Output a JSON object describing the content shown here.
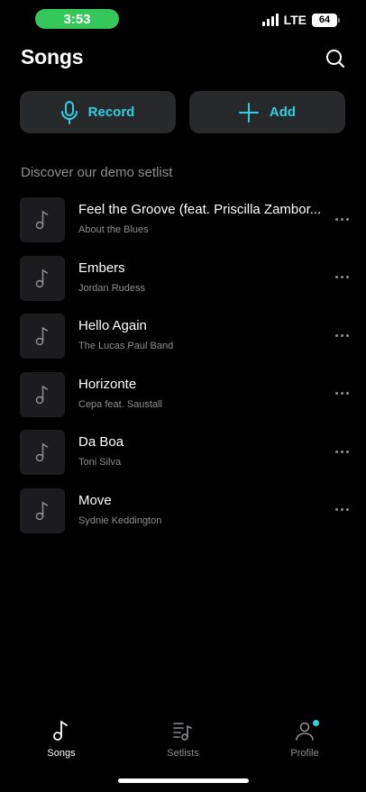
{
  "status_bar": {
    "time": "3:53",
    "network": "LTE",
    "battery": "64"
  },
  "header": {
    "title": "Songs"
  },
  "actions": {
    "record_label": "Record",
    "add_label": "Add"
  },
  "section": {
    "label": "Discover our demo setlist"
  },
  "songs": [
    {
      "title": "Feel the Groove (feat. Priscilla Zambor...",
      "artist": "About the Blues"
    },
    {
      "title": "Embers",
      "artist": "Jordan Rudess"
    },
    {
      "title": "Hello Again",
      "artist": "The Lucas Paul Band"
    },
    {
      "title": "Horizonte",
      "artist": "Cepa feat. Saustall"
    },
    {
      "title": "Da Boa",
      "artist": "Toni Silva"
    },
    {
      "title": "Move",
      "artist": "Sydnie Keddington"
    }
  ],
  "tabs": [
    {
      "label": "Songs",
      "icon": "music-note-icon",
      "active": true
    },
    {
      "label": "Setlists",
      "icon": "setlist-icon",
      "active": false
    },
    {
      "label": "Profile",
      "icon": "profile-icon",
      "active": false,
      "badge": true
    }
  ],
  "colors": {
    "accent": "#2ed0e4",
    "status_pill": "#35c759",
    "button_bg": "#27292b",
    "muted": "#8e8e93"
  }
}
